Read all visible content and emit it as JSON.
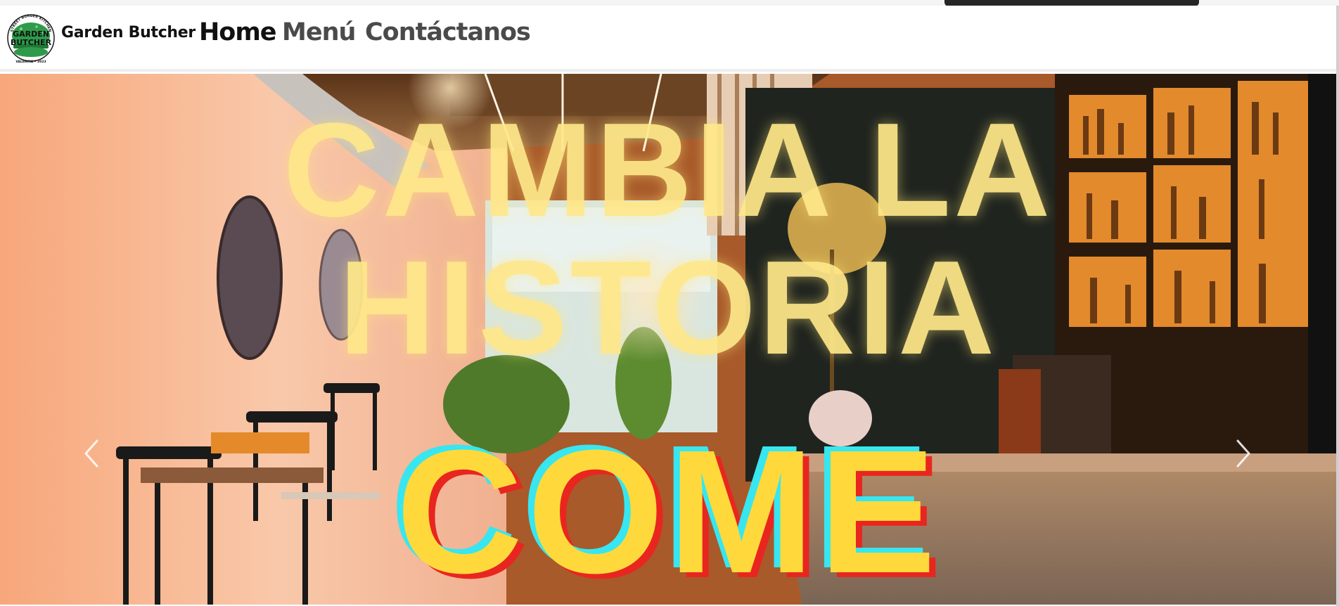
{
  "brand": {
    "name": "Garden Butcher",
    "logo_top_text": "STREET BURGER KITCHEN",
    "logo_line1": "GARDEN",
    "logo_line2": "BUTCHER",
    "logo_bottom_text": "VALENCIA • 2023"
  },
  "nav": {
    "items": [
      {
        "label": "Home",
        "active": true
      },
      {
        "label": "Menú",
        "active": false
      },
      {
        "label": "Contáctanos",
        "active": false
      }
    ]
  },
  "hero": {
    "headline_line1": "CAMBIA LA",
    "headline_line2": "HISTORIA",
    "word": "COME",
    "prev_icon": "chevron-left-icon",
    "next_icon": "chevron-right-icon"
  },
  "colors": {
    "headline": "#ffe88a",
    "word_fill": "#ffd93b",
    "word_cyan": "#37e6f0",
    "word_red": "#e8261f",
    "logo_green": "#2f9b4a"
  }
}
